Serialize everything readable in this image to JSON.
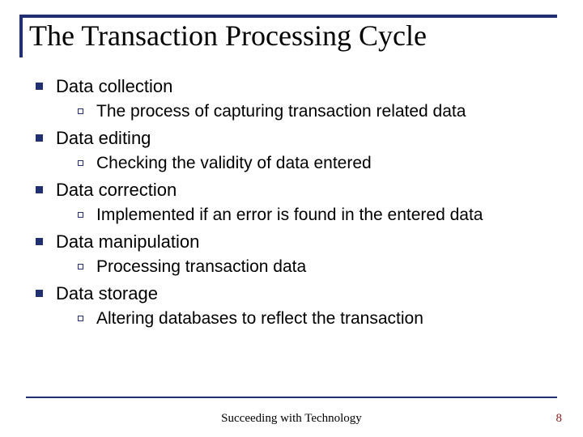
{
  "title": "The Transaction Processing Cycle",
  "items": [
    {
      "label": "Data collection",
      "sub": "The process of capturing transaction related data"
    },
    {
      "label": "Data editing",
      "sub": "Checking the validity of data entered"
    },
    {
      "label": "Data correction",
      "sub": "Implemented if an error is found in the entered data"
    },
    {
      "label": "Data manipulation",
      "sub": "Processing transaction data"
    },
    {
      "label": "Data storage",
      "sub": "Altering databases to reflect the transaction"
    }
  ],
  "footer": "Succeeding with Technology",
  "page": "8"
}
